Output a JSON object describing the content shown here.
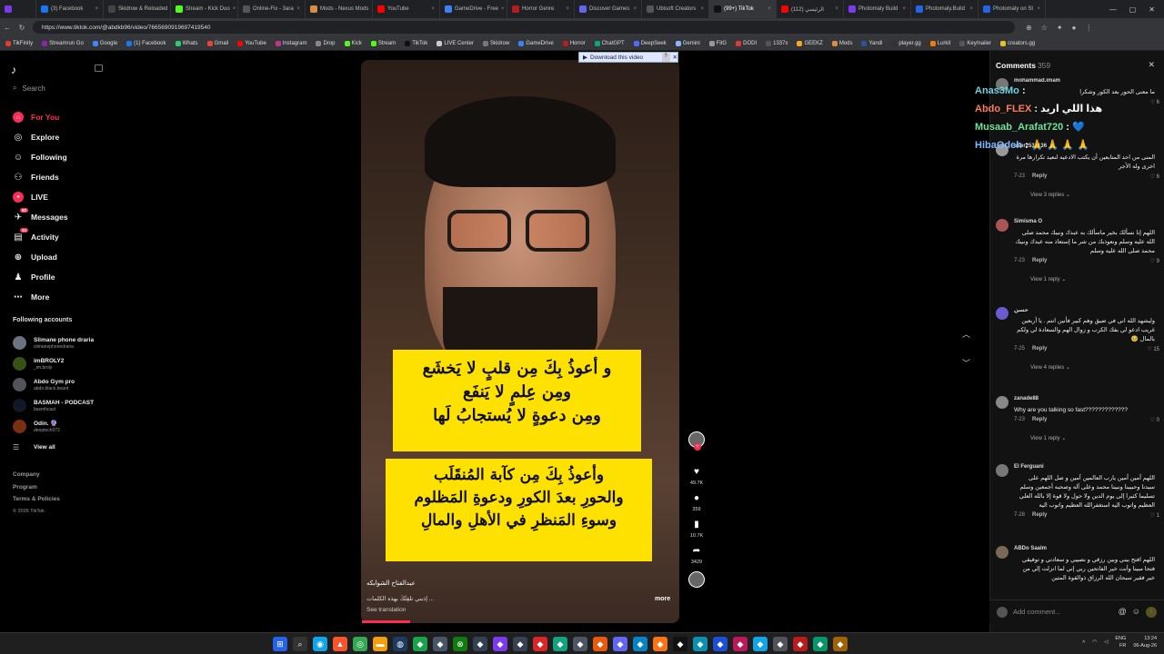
{
  "browser": {
    "tabs": [
      {
        "label": "(3) Facebook",
        "color": "#1877f2"
      },
      {
        "label": "Skidrow & Reloaded",
        "color": "#444"
      },
      {
        "label": "Stream - Kick Duo",
        "color": "#53fc18"
      },
      {
        "label": "Online-Fix - 3ara",
        "color": "#555"
      },
      {
        "label": "Mods - Nexus Mods",
        "color": "#d98f40"
      },
      {
        "label": "YouTube",
        "color": "#ff0000"
      },
      {
        "label": "GameDrive - Free",
        "color": "#3b82f6"
      },
      {
        "label": "Horror Genre",
        "color": "#b91c1c"
      },
      {
        "label": "Discover Games",
        "color": "#6366f1"
      },
      {
        "label": "Ubisoft Creators",
        "color": "#555"
      },
      {
        "label": "(99+) TikTok",
        "color": "#111",
        "active": true
      },
      {
        "label": "الرئيسي (112)",
        "color": "#ff0000"
      },
      {
        "label": "Photomaly Build",
        "color": "#7c3aed"
      },
      {
        "label": "Photomaly.Build",
        "color": "#2563eb"
      },
      {
        "label": "Photomaly on St",
        "color": "#2563eb"
      }
    ],
    "url": "https://www.tiktok.com/@abdkb96/video/7665690919697419540",
    "bookmarks": [
      "TikFinity",
      "Streamrun Go",
      "Google",
      "(1) Facebook",
      "Whats",
      "Gmail",
      "YouTube",
      "Instagram",
      "Drop",
      "Kick",
      "Stream",
      "TikTok",
      "LIVE Center",
      "Skidrow",
      "GameDrive",
      "Horror",
      "ChatGPT",
      "DeepSeek",
      "Gemini",
      "FitG",
      "DODI",
      "1337x",
      "GEEKZ",
      "Mods",
      "Yandi",
      "player.gg",
      "Lurkit",
      "Keymailer",
      "creators.gg"
    ]
  },
  "sidebar": {
    "search_placeholder": "Search",
    "nav": [
      {
        "label": "For You",
        "icon": "home-icon",
        "glyph": "⌂",
        "active": true
      },
      {
        "label": "Explore",
        "icon": "compass-icon",
        "glyph": "◎"
      },
      {
        "label": "Following",
        "icon": "following-icon",
        "glyph": "☺",
        "badge": ""
      },
      {
        "label": "Friends",
        "icon": "friends-icon",
        "glyph": "⚇"
      },
      {
        "label": "LIVE",
        "icon": "live-icon",
        "glyph": "●"
      },
      {
        "label": "Messages",
        "icon": "messages-icon",
        "glyph": "✈",
        "badge": "93"
      },
      {
        "label": "Activity",
        "icon": "activity-icon",
        "glyph": "▤",
        "badge": "34"
      },
      {
        "label": "Upload",
        "icon": "upload-icon",
        "glyph": "⊕"
      },
      {
        "label": "Profile",
        "icon": "profile-icon",
        "glyph": "♟"
      },
      {
        "label": "More",
        "icon": "more-icon",
        "glyph": "⋯"
      }
    ],
    "following_title": "Following accounts",
    "following": [
      {
        "name": "Slimane phone draria",
        "handle": "slimanephonedraria"
      },
      {
        "name": "imBROLY2",
        "handle": "_im.broly"
      },
      {
        "name": "Abdo Gym pro",
        "handle": "abdo.black.beard"
      },
      {
        "name": "BASMAH - PODCAST",
        "handle": "basmhcast"
      },
      {
        "name": "Odin. 🔮",
        "handle": "deeptech072"
      }
    ],
    "view_all": "View all",
    "footer": [
      "Company",
      "Program",
      "Terms & Policies"
    ],
    "copyright": "© 2026 TikTok"
  },
  "video": {
    "download_label": "Download this video",
    "caption_top": [
      "و أعوذُ بِكَ مِن قلبٍ لا يَخشَع",
      "ومِن عِلمٍ لا يَنفَع",
      "ومِن دعوةٍ لا يُستجابُ لَها"
    ],
    "caption_bottom": [
      "وأعوذُ بِكَ مِن كآبة المُنقَلَب",
      "والحورِ بعدَ الكورِ ودعوةِ المَظلوم",
      "وسوءِ المَنظرِ في الأهلِ والمالِ"
    ],
    "author": "عبدالفتاح الشوابكه",
    "description": "... إذبني تلقِتُكَ بهذه الكلمات",
    "see_translation": "See translation",
    "more": "more",
    "progress": 0.15,
    "likes": "49.7K",
    "comments": "359",
    "saves": "10.7K",
    "shares": "3429"
  },
  "comments_panel": {
    "title": "Comments",
    "count": "359",
    "items": [
      {
        "name": "mohammad.imam",
        "text": "ما معنى الحور بعد الكور وشكرا",
        "date": "",
        "likes": "6",
        "reply": ""
      },
      {
        "name": "user2534136",
        "text": "المنى من احد المتابعين أن يكتب الادعيه لنعيد تكرارها مرة اخرى وله الأجر",
        "date": "7-23",
        "likes": "6",
        "reply": "Reply",
        "replies": "View 3 replies"
      },
      {
        "name": "Simisma O",
        "text": "اللهم إنا نسألك بخير ماسألك به عبدك ونبيك محمد صلى الله عليه وسلم ونعوذبك من شر ما إستعاذ منه عبدك ونبيك محمد صلى الله عليه وسلم",
        "date": "7-23",
        "likes": "9",
        "reply": "Reply",
        "replies": "View 1 reply"
      },
      {
        "name": "حسن",
        "text": "وليشهد الله اني في ضيق وهم كبير فأنين انتم . يا أربعين غريب ادعو لي بفك الكرب و زوال الهم والسعادة لي ولكم بالمال 🥺",
        "date": "7-25",
        "likes": "15",
        "reply": "Reply",
        "replies": "View 4 replies"
      },
      {
        "name": "zanade88",
        "text": "Why are you talking so fast?????????????",
        "date": "7-23",
        "likes": "0",
        "reply": "Reply",
        "replies": "View 1 reply",
        "ltr": true
      },
      {
        "name": "El Ferguani",
        "text": "اللهم آمين آمين يارب العالمين آمين و صل اللهم على سيدنا وحبيبنا ونبينا محمد وعلى آله وصحبه أجمعين وسلم تسليما كثيرا إلى يوم الدين ولا حول ولا قوة إلا بالله العلي العظيم واتوب اليه استغفرالله العظيم واتوب اليه",
        "date": "7-28",
        "likes": "1",
        "reply": "Reply"
      },
      {
        "name": "ABDo Saalm",
        "text": "اللهم افتح بيني وبين رزقي و نصيبي و سعادتي و توفيقي فتحا مبينا وأنت خير الفاتحين ربي إني لما انزلت إلي من خير فقير سبحان الله الرزاق ذوالقوة المتين",
        "date": "",
        "likes": "",
        "reply": ""
      }
    ],
    "input_placeholder": "Add comment..."
  },
  "chat_overlay": [
    {
      "user": "Anas3Mo",
      "msg": ""
    },
    {
      "user": "Abdo_FLEX",
      "msg": "هذا اللي اريد"
    },
    {
      "user": "Musaab_Arafat720",
      "msg": "💙"
    },
    {
      "user": "HibaOdeh",
      "msg": "🙏 🙏 🙏 🙏"
    }
  ],
  "taskbar": {
    "lang": "ENG",
    "lang2": "FR",
    "time": "13:24",
    "date": "06-Aug-26"
  }
}
